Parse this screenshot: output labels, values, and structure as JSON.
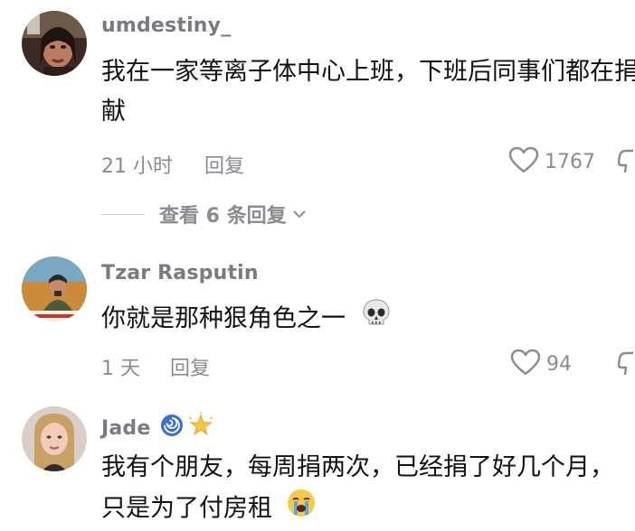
{
  "comments": [
    {
      "username": "umdestiny_",
      "text": "我在一家等离子体中心上班，下班后同事们都在捐献",
      "time": "21 小时",
      "reply_label": "回复",
      "likes": "1767",
      "view_replies_label": "查看 6 条回复"
    },
    {
      "username": "Tzar Rasputin",
      "text": "你就是那种狠角色之一",
      "emoji": "skull",
      "time": "1 天",
      "reply_label": "回复",
      "likes": "94"
    },
    {
      "username": "Jade",
      "username_emojis": [
        "cyclone",
        "glowing-star"
      ],
      "text": "我有个朋友，每周捐两次，已经捐了好几个月，只是为了付房租",
      "emoji": "loudly-crying-face"
    }
  ],
  "colors": {
    "meta_gray": "#8a8b91",
    "username_gray": "#7a7a82",
    "text": "#111111"
  }
}
